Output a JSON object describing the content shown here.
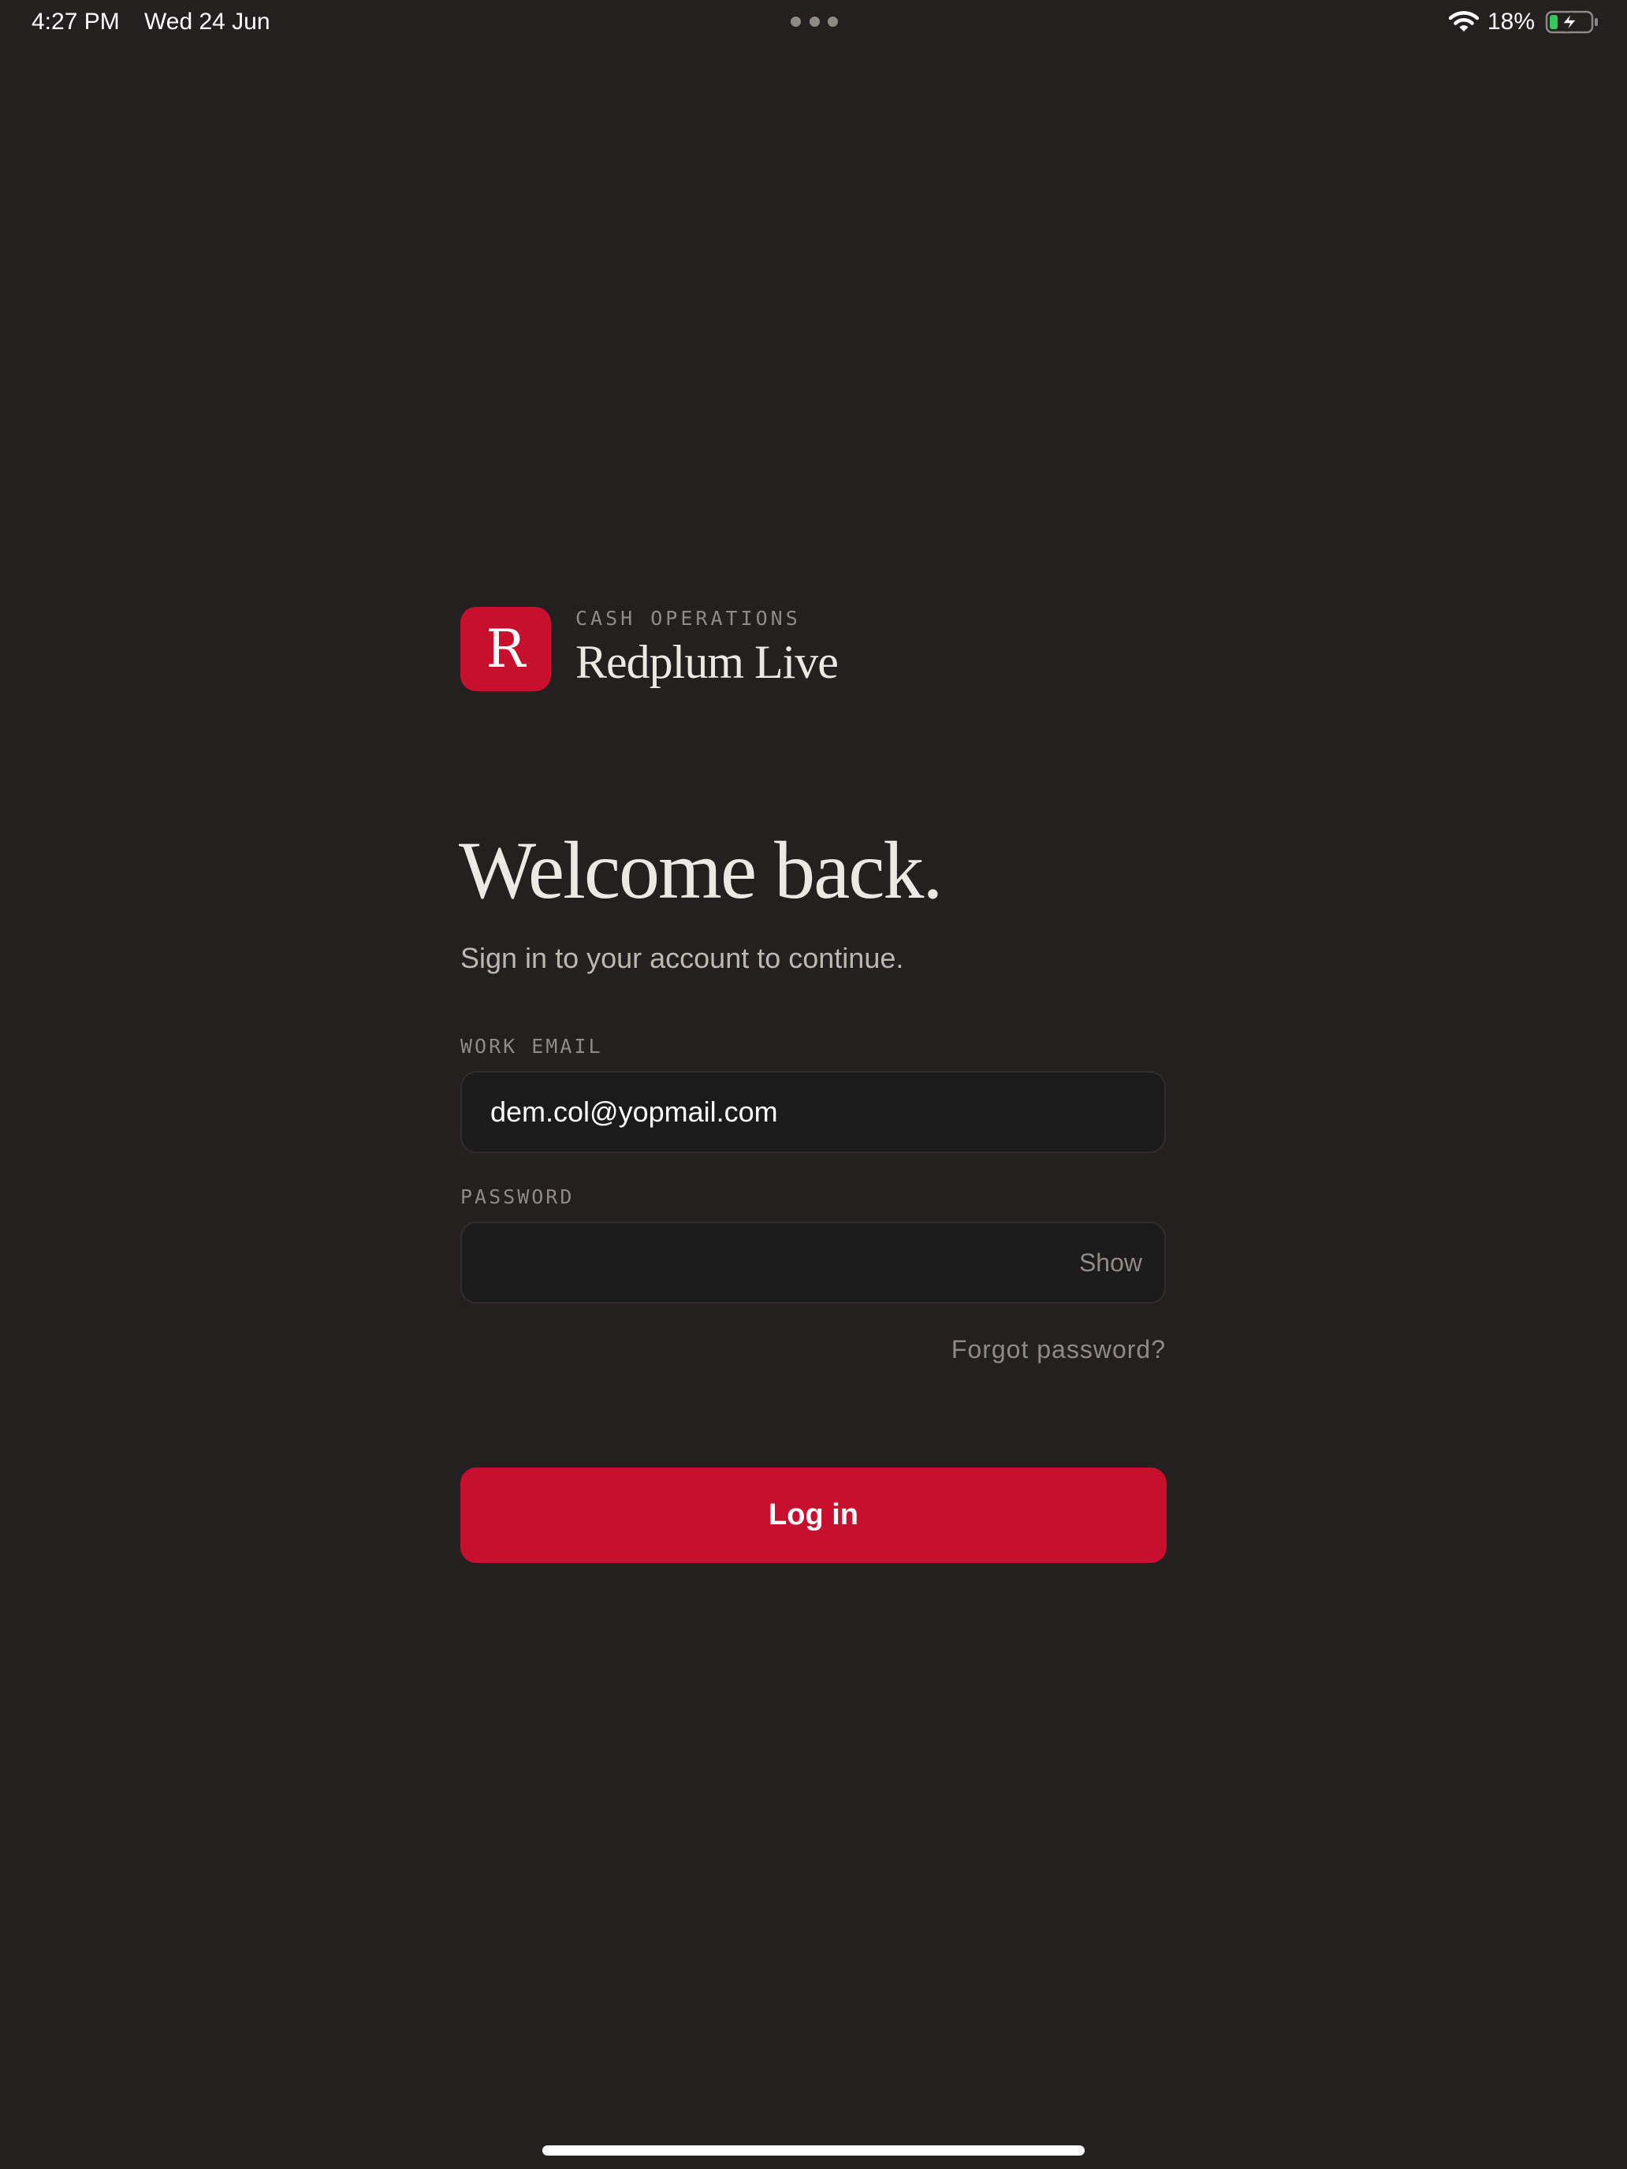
{
  "status_bar": {
    "time": "4:27 PM",
    "date": "Wed 24 Jun",
    "battery": "18%",
    "wifi_icon": "wifi-icon",
    "battery_icon": "battery-charging-icon",
    "multitask_icon": "ellipsis-icon"
  },
  "brand": {
    "logo_letter": "R",
    "eyebrow": "CASH OPERATIONS",
    "name": "Redplum Live",
    "accent_color": "#c8102e"
  },
  "heading": {
    "title": "Welcome back.",
    "subtitle": "Sign in to your account to continue."
  },
  "form": {
    "email_label": "WORK EMAIL",
    "email_value": "dem.col@yopmail.com",
    "password_label": "PASSWORD",
    "password_value": "",
    "show_label": "Show",
    "forgot_label": "Forgot password?",
    "login_label": "Log in"
  },
  "colors": {
    "background": "#242020",
    "field_background": "#1c1b1b",
    "muted_text": "#8f8a86",
    "battery_green": "#34c759"
  }
}
